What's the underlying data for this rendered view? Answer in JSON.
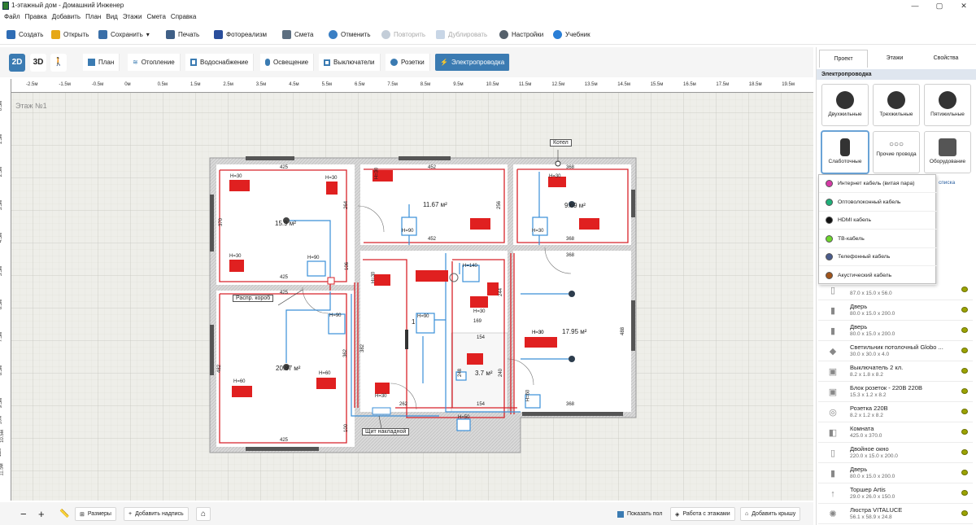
{
  "window": {
    "title": "1-этажный дом - Домашний Инженер",
    "minimize": "—",
    "maximize": "▢",
    "close": "✕"
  },
  "menu": [
    "Файл",
    "Правка",
    "Добавить",
    "План",
    "Вид",
    "Этажи",
    "Смета",
    "Справка"
  ],
  "toolbar": {
    "create": "Создать",
    "open": "Открыть",
    "save": "Сохранить",
    "save_caret": "▾",
    "print": "Печать",
    "photorealism": "Фотореализм",
    "estimate": "Смета",
    "undo": "Отменить",
    "redo": "Повторить",
    "duplicate": "Дублировать",
    "settings": "Настройки",
    "tutorial": "Учебник"
  },
  "view_modes": {
    "v2d": "2D",
    "v3d": "3D",
    "walk": "🚶"
  },
  "mode_tabs": [
    "План",
    "Отопление",
    "Водоснабжение",
    "Освещение",
    "Выключатели",
    "Розетки",
    "Электропроводка"
  ],
  "active_mode": "Электропроводка",
  "ruler_h": [
    "-2.5м",
    "-1.5м",
    "-0.5м",
    "0м",
    "0.5м",
    "1.5м",
    "2.5м",
    "3.5м",
    "4.5м",
    "5.5м",
    "6.5м",
    "7.5м",
    "8.5м",
    "9.5м",
    "10.5м",
    "11.5м",
    "12.5м",
    "13.5м",
    "14.5м",
    "15.5м",
    "16.5м",
    "17.5м",
    "18.5м",
    "19.5м",
    "20.5м"
  ],
  "ruler_h2": [
    "-2м",
    "-1м",
    "1м",
    "2м",
    "3м",
    "4м",
    "5м",
    "6м",
    "7м",
    "8м",
    "9м",
    "10м",
    "11м",
    "12м",
    "13м",
    "14м",
    "15м",
    "16м",
    "17м",
    "18м",
    "19м",
    "20м"
  ],
  "ruler_v": [
    "0.5м",
    "1м",
    "1.5м",
    "2м",
    "2.5м",
    "3м",
    "3.5м",
    "4м",
    "4.5м",
    "5м",
    "5.5м",
    "6м",
    "6.5м",
    "7м",
    "7.5м",
    "8м",
    "8.5м",
    "9м",
    "9.5м",
    "10м",
    "10.5м",
    "11м",
    "11.5м"
  ],
  "plan": {
    "floor_label": "Этаж №1",
    "rooms": [
      {
        "area": "15.9 м²"
      },
      {
        "area": "11.67 м²"
      },
      {
        "area": "9.69 м²"
      },
      {
        "area": "17.95 м²"
      },
      {
        "area": "20.87 м²"
      },
      {
        "area": "1"
      },
      {
        "area": "3.7 м²"
      }
    ],
    "callouts": {
      "boiler": "Котел",
      "junction": "Распр. короб",
      "panel": "Щит накладной"
    },
    "dims": [
      "425",
      "452",
      "368",
      "425",
      "370",
      "264",
      "106",
      "256",
      "452",
      "368",
      "368",
      "425",
      "488",
      "154",
      "154",
      "362",
      "382",
      "262",
      "248",
      "244",
      "240",
      "368",
      "425",
      "100",
      "482",
      "368",
      "169"
    ],
    "heights": [
      "H=30",
      "H=30",
      "H=30",
      "H=30",
      "H=30",
      "H=90",
      "H=90",
      "H=30",
      "H=30",
      "H=30",
      "H=30",
      "H=90",
      "H=60",
      "H=60",
      "H=30",
      "H=90",
      "H=90",
      "H=30",
      "H=140",
      "H=30",
      "H=60",
      "H=50",
      "H=30",
      "H=30"
    ]
  },
  "bottom": {
    "zoom_out": "−",
    "zoom_in": "+",
    "sizes": "Размеры",
    "add_label": "Добавить надпись",
    "home": "⌂",
    "show_floor": "Показать пол",
    "floors_work": "Работа с этажами",
    "add_roof": "Добавить крышу"
  },
  "panel": {
    "tabs": [
      "Проект",
      "Этажи",
      "Свойства"
    ],
    "section": "Электропроводка",
    "wire_buttons": [
      "Двухжильные",
      "Трехжильные",
      "Пятижильные",
      "Слаботочные",
      "Прочие провода",
      "Оборудование"
    ],
    "list_label": "списка",
    "dropdown": [
      {
        "label": "Интернет кабель (витая пара)",
        "color": "#d63aa6"
      },
      {
        "label": "Оптоволоконный кабель",
        "color": "#1fb07a"
      },
      {
        "label": "HDMI кабель",
        "color": "#111111"
      },
      {
        "label": "ТВ-кабель",
        "color": "#6dd62d"
      },
      {
        "label": "Телефонный кабель",
        "color": "#4a5c8c"
      },
      {
        "label": "Акустический кабель",
        "color": "#a0541a"
      }
    ],
    "items": [
      {
        "name": "",
        "dims": "87.0 x 15.0 x 56.0",
        "icon": "window"
      },
      {
        "name": "Дверь",
        "dims": "80.0 x 15.0 x 200.0",
        "icon": "door"
      },
      {
        "name": "Дверь",
        "dims": "80.0 x 15.0 x 200.0",
        "icon": "door"
      },
      {
        "name": "Светильник потолочный Globo ...",
        "dims": "30.0 x 30.0 x 4.0",
        "icon": "lamp"
      },
      {
        "name": "Выключатель 2 кл.",
        "dims": "8.2 x 1.8 x 8.2",
        "icon": "switch"
      },
      {
        "name": "Блок розеток - 220В 220В",
        "dims": "15.3 x 1.2 x 8.2",
        "icon": "socket-block"
      },
      {
        "name": "Розетка 220В",
        "dims": "8.2 x 1.2 x 8.2",
        "icon": "socket"
      },
      {
        "name": "Комната",
        "dims": "425.0 x 370.0",
        "icon": "room"
      },
      {
        "name": "Двойное окно",
        "dims": "220.0 x 15.0 x 200.0",
        "icon": "window"
      },
      {
        "name": "Дверь",
        "dims": "80.0 x 15.0 x 200.0",
        "icon": "door"
      },
      {
        "name": "Торшер Artis",
        "dims": "29.0 x 26.0 x 150.0",
        "icon": "floor-lamp"
      },
      {
        "name": "Люстра VITALUCE",
        "dims": "56.1 x 58.9 x 24.8",
        "icon": "chandelier"
      }
    ]
  },
  "colors": {
    "accent": "#3b7bb2",
    "wire_red": "#d8232a",
    "wire_blue": "#3a8fd8",
    "wall": "#c8c8c8"
  }
}
